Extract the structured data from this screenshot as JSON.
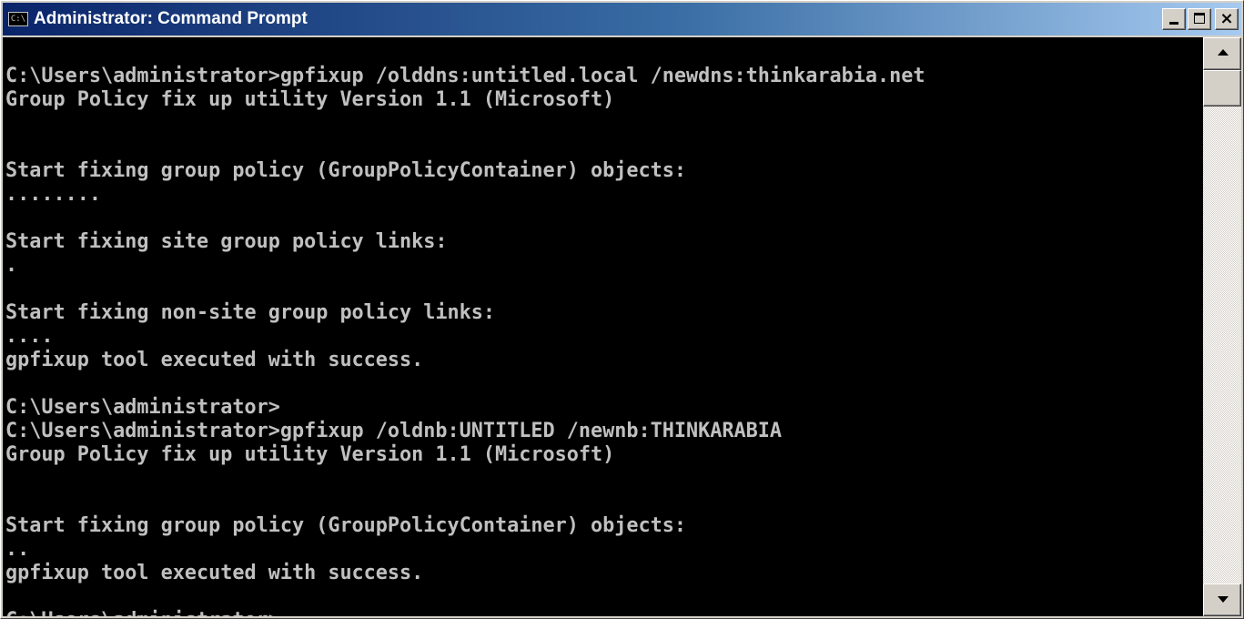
{
  "window": {
    "title": "Administrator: Command Prompt",
    "icon": "cmd-icon",
    "icon_text": "C:\\",
    "buttons": {
      "minimize": "minimize-icon",
      "maximize": "maximize-icon",
      "close": "close-icon",
      "close_glyph": "×"
    }
  },
  "console": {
    "lines": [
      "C:\\Users\\administrator>gpfixup /olddns:untitled.local /newdns:thinkarabia.net",
      "Group Policy fix up utility Version 1.1 (Microsoft)",
      "",
      "",
      "Start fixing group policy (GroupPolicyContainer) objects:",
      "........",
      "",
      "Start fixing site group policy links:",
      ".",
      "",
      "Start fixing non-site group policy links:",
      "....",
      "gpfixup tool executed with success.",
      "",
      "C:\\Users\\administrator>",
      "C:\\Users\\administrator>gpfixup /oldnb:UNTITLED /newnb:THINKARABIA",
      "Group Policy fix up utility Version 1.1 (Microsoft)",
      "",
      "",
      "Start fixing group policy (GroupPolicyContainer) objects:",
      "..",
      "gpfixup tool executed with success.",
      "",
      "C:\\Users\\administrator>"
    ]
  },
  "colors": {
    "console_background": "#000000",
    "console_text": "#c0c0c0",
    "titlebar_start": "#0a246a",
    "titlebar_end": "#a6caf0"
  }
}
